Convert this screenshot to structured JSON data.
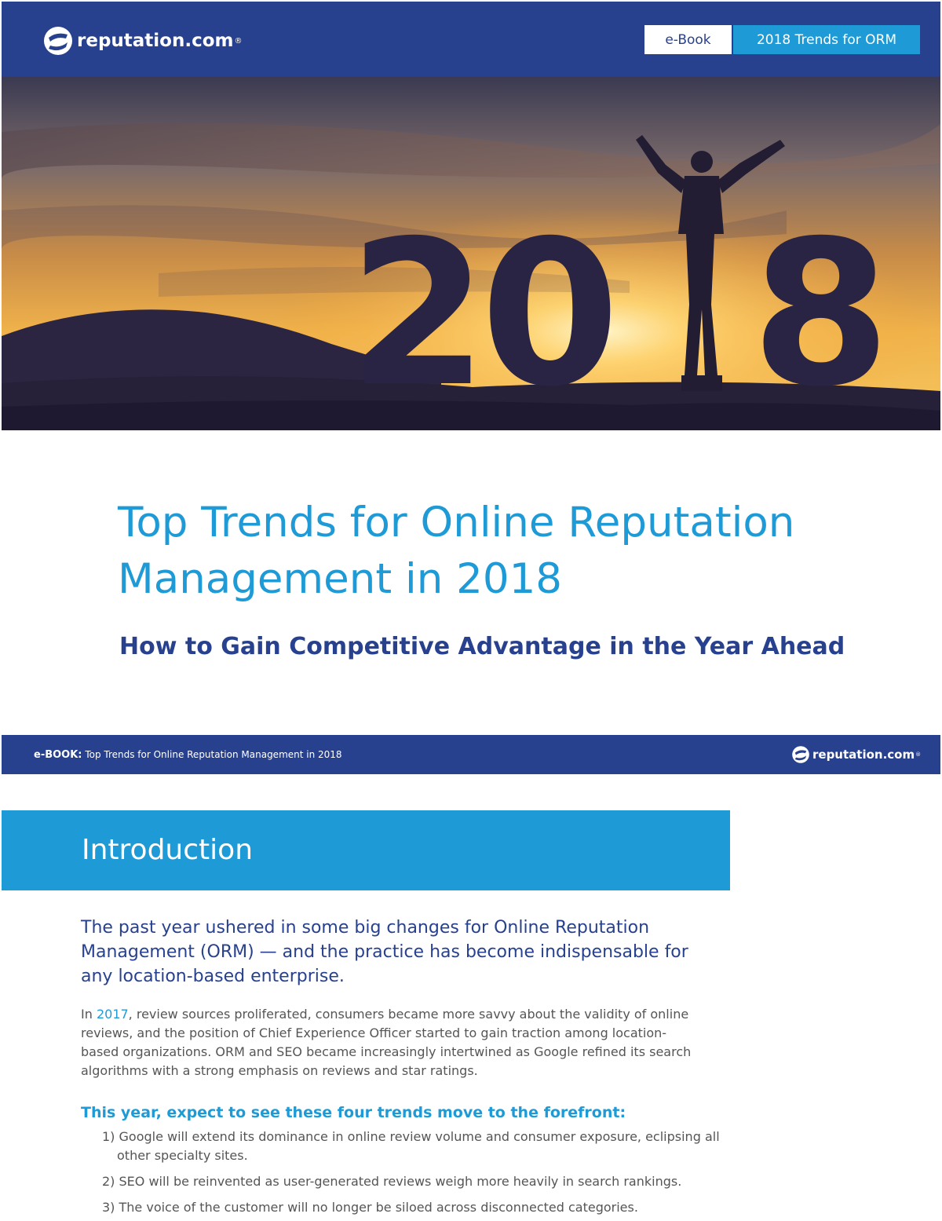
{
  "header": {
    "logo_text": "reputation.com",
    "logo_reg": "®",
    "tag_ebook": "e-Book",
    "tag_trends": "2018 Trends for ORM"
  },
  "hero": {
    "year_digit_1": "2",
    "year_digit_2": "0",
    "year_digit_3": "8"
  },
  "title": {
    "line1": "Top Trends for Online Reputation",
    "line2": "Management in 2018",
    "subtitle": "How to Gain Competitive Advantage in the Year Ahead"
  },
  "midbar": {
    "prefix": "e-BOOK:",
    "title": "Top Trends for Online Reputation Management in 2018",
    "logo_text": "reputation.com",
    "logo_reg": "®"
  },
  "intro": {
    "heading": "Introduction",
    "lead": "The past year ushered in some big changes for Online Reputation Management (ORM) — and the practice has become indispensable for any location-based enterprise.",
    "body_prefix": "In ",
    "body_link": "2017",
    "body_rest": ", review sources proliferated, consumers became more savvy about the validity of online reviews, and the position of Chief Experience Officer started to gain traction among location-based organizations. ORM and SEO became increasingly intertwined as Google refined its search algorithms with a strong emphasis on reviews and star ratings.",
    "expect_heading": "This year, expect to see these four trends move to the forefront:",
    "trends": [
      "1) Google will extend its dominance in online review volume and consumer exposure, eclipsing all other specialty sites.",
      "2) SEO will be reinvented as user-generated reviews weigh more heavily in search rankings.",
      "3) The voice of the customer will no longer be siloed across disconnected categories."
    ]
  },
  "colors": {
    "navy": "#27418f",
    "blue": "#1e9bd7"
  }
}
